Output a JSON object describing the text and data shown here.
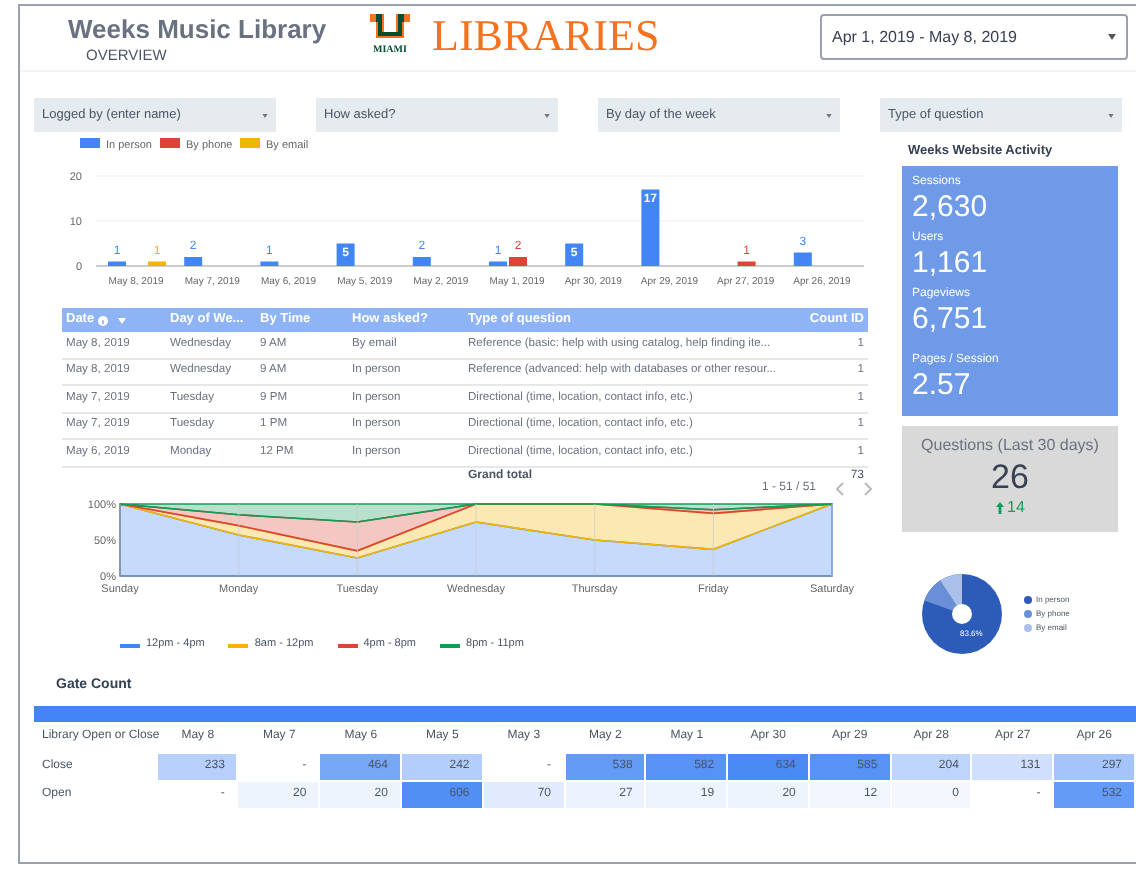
{
  "header": {
    "title": "Weeks Music Library",
    "subtitle": "OVERVIEW",
    "logo_small": "MIAMI",
    "logo_text": "LIBRARIES",
    "date_range": "Apr 1, 2019 - May 8, 2019"
  },
  "filters": [
    "Logged by (enter name)",
    "How asked?",
    "By day of the week",
    "Type of question"
  ],
  "bar_chart": {
    "chart_data": {
      "type": "bar",
      "categories": [
        "May 8, 2019",
        "May 7, 2019",
        "May 6, 2019",
        "May 5, 2019",
        "May 2, 2019",
        "May 1, 2019",
        "Apr 30, 2019",
        "Apr 29, 2019",
        "Apr 27, 2019",
        "Apr 26, 2019"
      ],
      "series": [
        {
          "name": "In person",
          "color": "#4285f4",
          "values": [
            1,
            2,
            1,
            5,
            2,
            1,
            5,
            17,
            null,
            3
          ]
        },
        {
          "name": "By phone",
          "color": "#db4437",
          "values": [
            null,
            null,
            null,
            null,
            null,
            2,
            null,
            null,
            1,
            null
          ]
        },
        {
          "name": "By email",
          "color": "#f4b400",
          "values": [
            1,
            null,
            null,
            null,
            null,
            null,
            null,
            null,
            null,
            null
          ]
        }
      ],
      "ylim": [
        0,
        20
      ],
      "yticks": [
        0,
        10,
        20
      ],
      "data_labels": true,
      "legend": "top",
      "grid": true
    }
  },
  "table": {
    "columns": [
      "Date",
      "Day of We...",
      "By Time",
      "How asked?",
      "Type of question",
      "Count ID"
    ],
    "rows": [
      [
        "May 8, 2019",
        "Wednesday",
        "9 AM",
        "By email",
        "Reference (basic: help with using catalog, help finding ite...",
        "1"
      ],
      [
        "May 8, 2019",
        "Wednesday",
        "9 AM",
        "In person",
        "Reference (advanced: help with databases or other resour...",
        "1"
      ],
      [
        "May 7, 2019",
        "Tuesday",
        "9 PM",
        "In person",
        "Directional (time, location, contact info, etc.)",
        "1"
      ],
      [
        "May 7, 2019",
        "Tuesday",
        "1 PM",
        "In person",
        "Directional (time, location, contact info, etc.)",
        "1"
      ],
      [
        "May 6, 2019",
        "Monday",
        "12 PM",
        "In person",
        "Directional (time, location, contact info, etc.)",
        "1"
      ]
    ],
    "grand_total": {
      "label": "Grand total",
      "value": "73"
    },
    "pagination": "1 - 51 / 51"
  },
  "time_chart": {
    "chart_data": {
      "type": "area",
      "stacked": true,
      "categories": [
        "Sunday",
        "Monday",
        "Tuesday",
        "Wednesday",
        "Thursday",
        "Friday",
        "Saturday"
      ],
      "series": [
        {
          "name": "12pm - 4pm",
          "color": "#4285f4",
          "values": [
            100,
            57,
            25,
            75,
            50,
            37,
            100
          ]
        },
        {
          "name": "8am - 12pm",
          "color": "#f4b400",
          "values": [
            0,
            13,
            10,
            25,
            50,
            50,
            0
          ]
        },
        {
          "name": "4pm - 8pm",
          "color": "#db4437",
          "values": [
            0,
            15,
            40,
            0,
            0,
            5,
            0
          ]
        },
        {
          "name": "8pm - 11pm",
          "color": "#0f9d58",
          "values": [
            0,
            15,
            25,
            0,
            0,
            8,
            0
          ]
        }
      ],
      "ylim": [
        0,
        100
      ],
      "legend": "bottom",
      "grid": true,
      "yticks": [
        {
          "value": 0,
          "label": "0%"
        },
        {
          "value": 50,
          "label": "50%"
        },
        {
          "value": 100,
          "label": "100%"
        }
      ]
    }
  },
  "website_activity": {
    "title": "Weeks Website Activity",
    "metrics": [
      {
        "label": "Sessions",
        "value": "2,630"
      },
      {
        "label": "Users",
        "value": "1,161"
      },
      {
        "label": "Pageviews",
        "value": "6,751"
      },
      {
        "label": "Pages / Session",
        "value": "2.57"
      }
    ]
  },
  "questions": {
    "title": "Questions (Last 30 days)",
    "value": "26",
    "change": "14"
  },
  "pie": {
    "label": "83.6%",
    "legend": [
      {
        "name": "In person",
        "color": "#2c5bb8"
      },
      {
        "name": "By phone",
        "color": "#6a8fd6"
      },
      {
        "name": "By email",
        "color": "#aac0ea"
      }
    ]
  },
  "gate_count": {
    "title": "Gate Count",
    "columns": [
      "Library Open or Close",
      "May 8",
      "May 7",
      "May 6",
      "May 5",
      "May 3",
      "May 2",
      "May 1",
      "Apr 30",
      "Apr 29",
      "Apr 28",
      "Apr 27",
      "Apr 26"
    ],
    "rows": [
      {
        "label": "Close",
        "values": [
          "233",
          "-",
          "464",
          "242",
          "-",
          "538",
          "582",
          "634",
          "585",
          "204",
          "131",
          "297"
        ]
      },
      {
        "label": "Open",
        "values": [
          "-",
          "20",
          "20",
          "606",
          "70",
          "27",
          "19",
          "20",
          "12",
          "0",
          "-",
          "532"
        ]
      }
    ]
  }
}
